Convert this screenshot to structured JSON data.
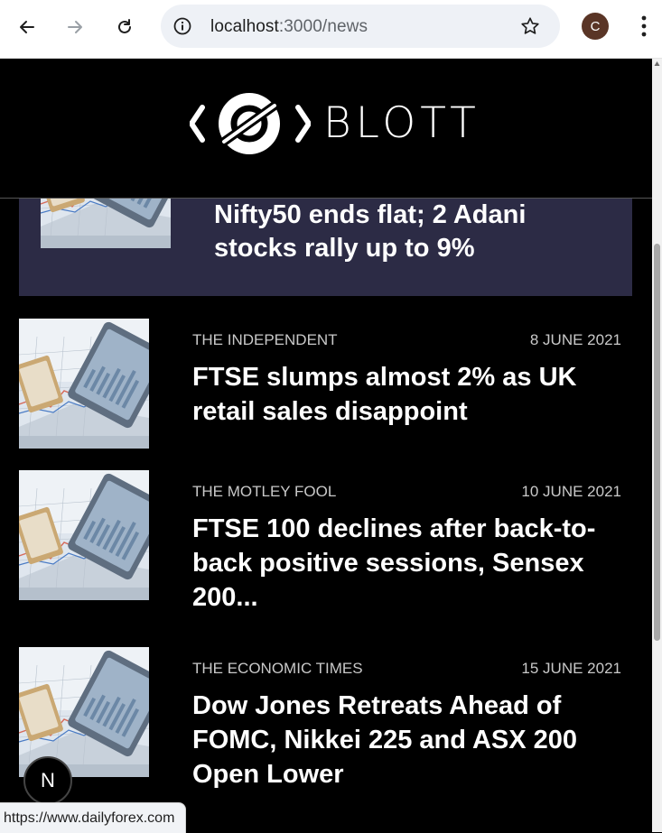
{
  "browser": {
    "url_host": "localhost",
    "url_path": ":3000/news",
    "profile_initial": "C",
    "status_link": "https://www.dailyforex.com"
  },
  "site": {
    "brand": "BLOTT"
  },
  "featured": {
    "title": "Nifty50 ends flat; 2 Adani stocks rally up to 9%"
  },
  "news": [
    {
      "source": "THE INDEPENDENT",
      "date": "8 JUNE 2021",
      "title": "FTSE slumps almost 2% as UK retail sales disappoint"
    },
    {
      "source": "THE MOTLEY FOOL",
      "date": "10 JUNE 2021",
      "title": "FTSE 100 declines after back-to-back positive sessions, Sensex 200..."
    },
    {
      "source": "THE ECONOMIC TIMES",
      "date": "15 JUNE 2021",
      "title": "Dow Jones Retreats Ahead of FOMC, Nikkei 225 and ASX 200 Open Lower"
    }
  ],
  "badge": {
    "letter": "N"
  }
}
